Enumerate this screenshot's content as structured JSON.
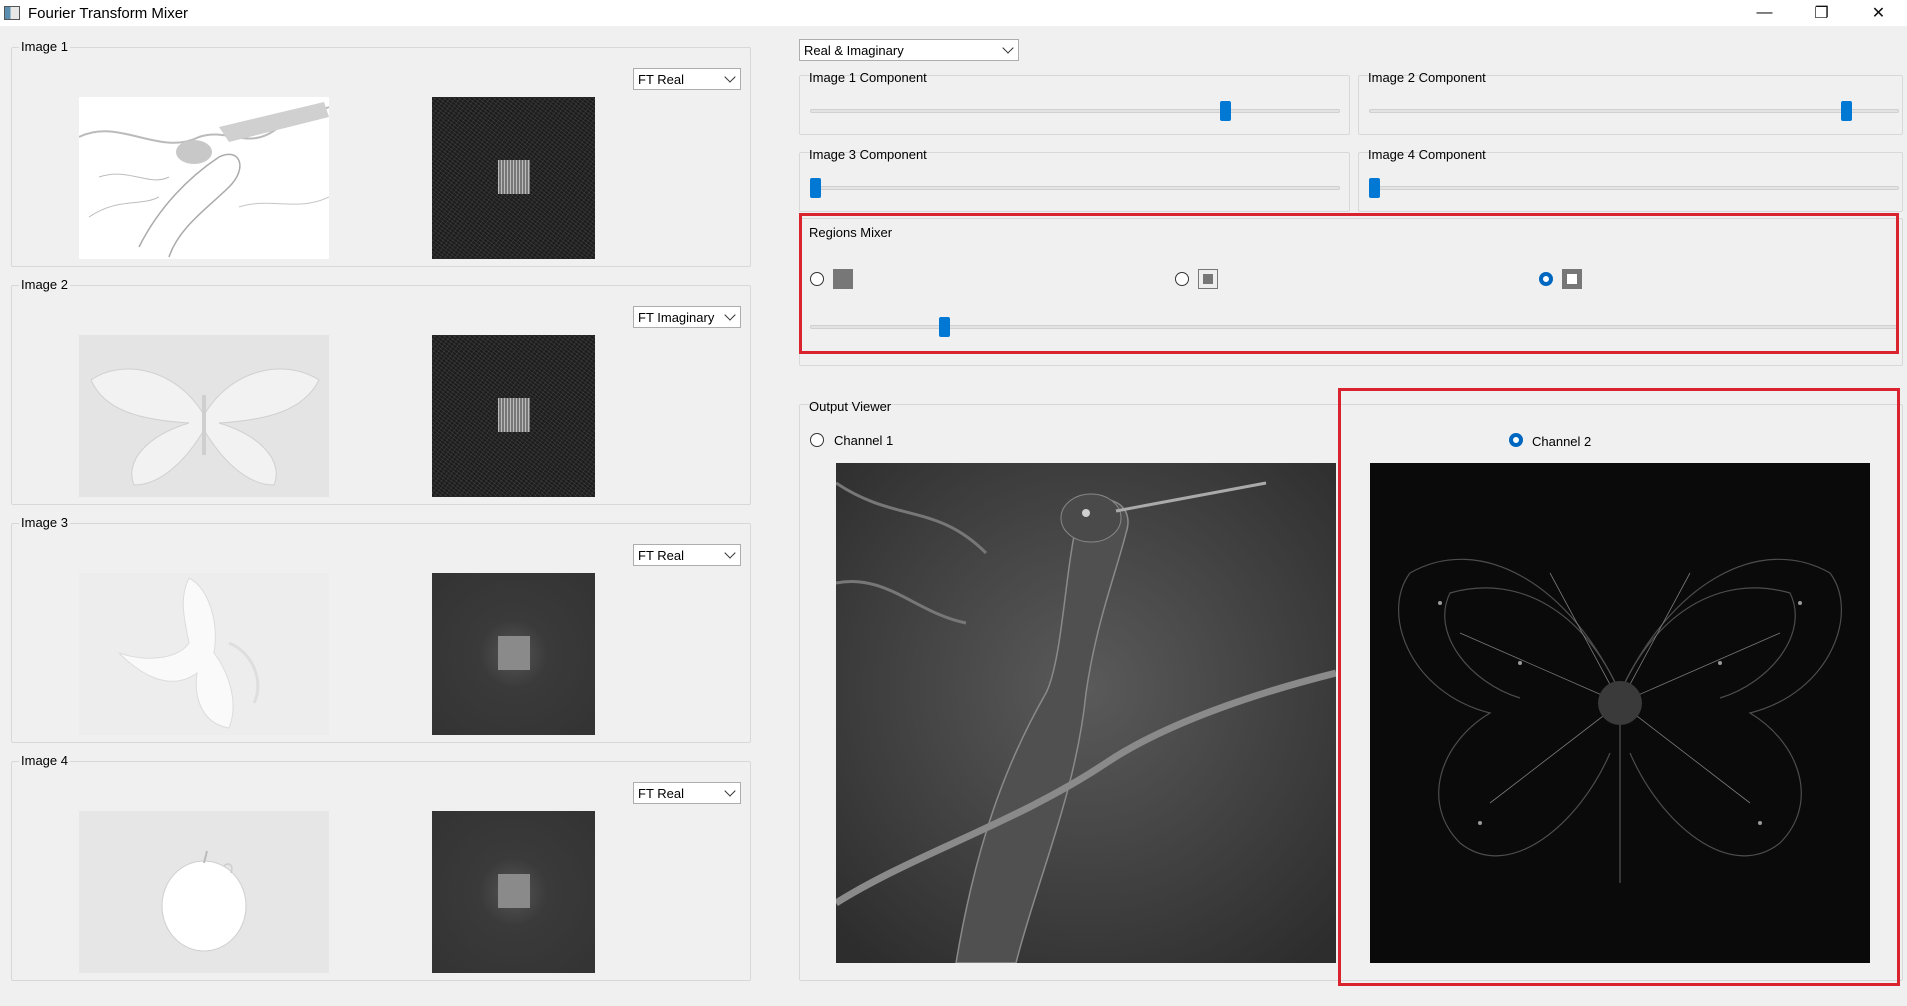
{
  "window": {
    "title": "Fourier Transform Mixer",
    "minimize_glyph": "—",
    "restore_glyph": "❐",
    "close_glyph": "✕"
  },
  "images": [
    {
      "title": "Image 1",
      "component": "FT Real",
      "picture": "hand-icon"
    },
    {
      "title": "Image 2",
      "component": "FT Imaginary",
      "picture": "butterfly-icon"
    },
    {
      "title": "Image 3",
      "component": "FT Real",
      "picture": "banana-icon"
    },
    {
      "title": "Image 4",
      "component": "FT Real",
      "picture": "apple-icon"
    }
  ],
  "mixer": {
    "mode": "Real & Imaginary",
    "components": [
      {
        "label": "Image 1 Component",
        "value": 0.79
      },
      {
        "label": "Image 2 Component",
        "value": 0.91
      },
      {
        "label": "Image 3 Component",
        "value": 0.0
      },
      {
        "label": "Image 4 Component",
        "value": 0.0
      }
    ]
  },
  "regions": {
    "title": "Regions Mixer",
    "selected_option": 3,
    "slider_value": 0.12
  },
  "output": {
    "title": "Output Viewer",
    "channel1_label": "Channel 1",
    "channel2_label": "Channel 2",
    "selected_channel": 2
  },
  "colors": {
    "accent": "#0078d4",
    "highlight": "#d9232e"
  }
}
